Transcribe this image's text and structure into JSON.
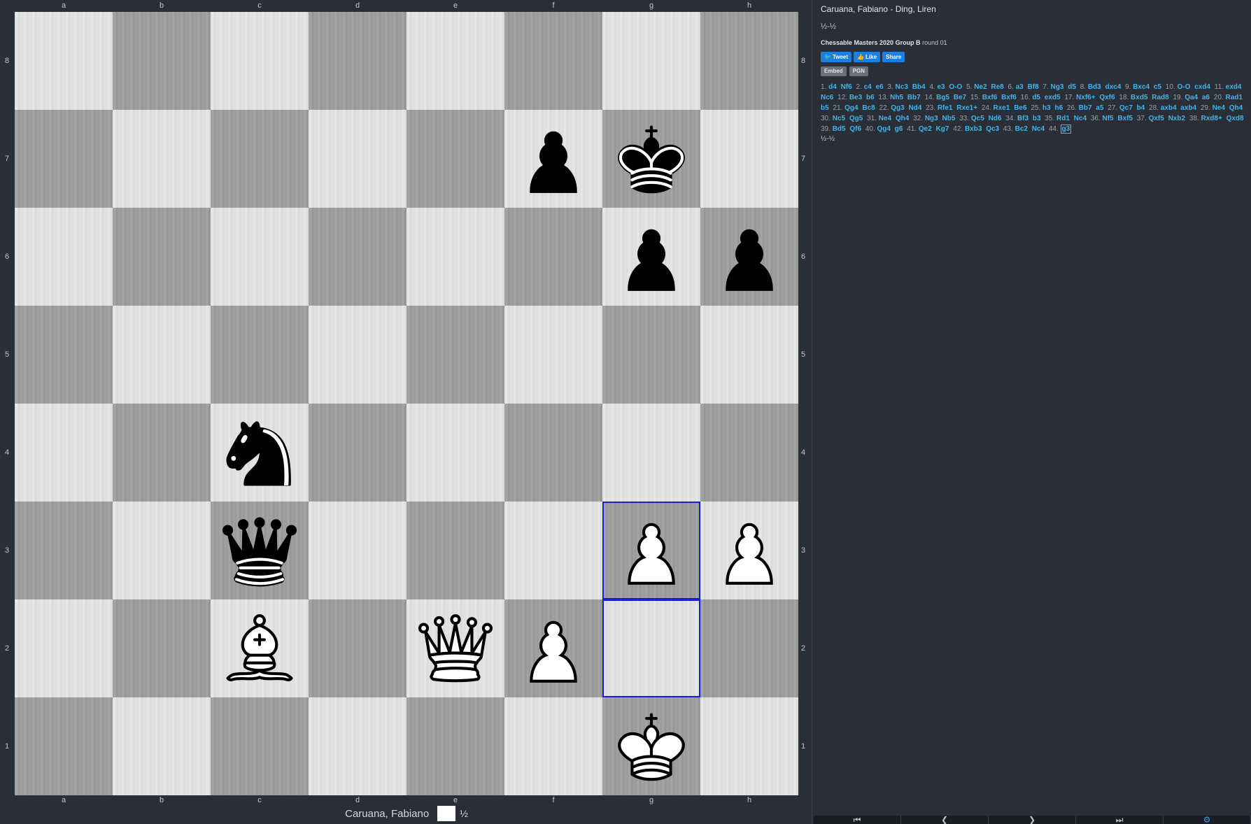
{
  "board": {
    "files": [
      "a",
      "b",
      "c",
      "d",
      "e",
      "f",
      "g",
      "h"
    ],
    "ranks": [
      "8",
      "7",
      "6",
      "5",
      "4",
      "3",
      "2",
      "1"
    ],
    "colors": {
      "light": "#e0e0e0",
      "dark": "#9d9d9d",
      "highlight": "#1a1ad8"
    },
    "highlighted_squares": [
      "g3",
      "g2"
    ],
    "pieces": [
      {
        "square": "f7",
        "piece": "black-pawn"
      },
      {
        "square": "g7",
        "piece": "black-king"
      },
      {
        "square": "g6",
        "piece": "black-pawn"
      },
      {
        "square": "h6",
        "piece": "black-pawn"
      },
      {
        "square": "c4",
        "piece": "black-knight"
      },
      {
        "square": "c3",
        "piece": "black-queen"
      },
      {
        "square": "g3",
        "piece": "white-pawn"
      },
      {
        "square": "h3",
        "piece": "white-pawn"
      },
      {
        "square": "c2",
        "piece": "white-bishop"
      },
      {
        "square": "e2",
        "piece": "white-queen"
      },
      {
        "square": "f2",
        "piece": "white-pawn"
      },
      {
        "square": "g1",
        "piece": "white-king"
      }
    ]
  },
  "player_bar": {
    "name": "Caruana, Fabiano",
    "score": "½"
  },
  "game": {
    "title": "Caruana, Fabiano - Ding, Liren",
    "result": "½-½",
    "event": "Chessable Masters 2020 Group B",
    "round": "round 01"
  },
  "social": {
    "tweet": "Tweet",
    "like": "Like",
    "share": "Share"
  },
  "tools": {
    "embed": "Embed",
    "pgn": "PGN"
  },
  "moves": [
    {
      "n": "1.",
      "w": "d4",
      "b": "Nf6"
    },
    {
      "n": "2.",
      "w": "c4",
      "b": "e6"
    },
    {
      "n": "3.",
      "w": "Nc3",
      "b": "Bb4"
    },
    {
      "n": "4.",
      "w": "e3",
      "b": "O-O"
    },
    {
      "n": "5.",
      "w": "Ne2",
      "b": "Re8"
    },
    {
      "n": "6.",
      "w": "a3",
      "b": "Bf8"
    },
    {
      "n": "7.",
      "w": "Ng3",
      "b": "d5"
    },
    {
      "n": "8.",
      "w": "Bd3",
      "b": "dxc4"
    },
    {
      "n": "9.",
      "w": "Bxc4",
      "b": "c5"
    },
    {
      "n": "10.",
      "w": "O-O",
      "b": "cxd4"
    },
    {
      "n": "11.",
      "w": "exd4",
      "b": "Nc6"
    },
    {
      "n": "12.",
      "w": "Be3",
      "b": "b6"
    },
    {
      "n": "13.",
      "w": "Nh5",
      "b": "Bb7"
    },
    {
      "n": "14.",
      "w": "Bg5",
      "b": "Be7"
    },
    {
      "n": "15.",
      "w": "Bxf6",
      "b": "Bxf6"
    },
    {
      "n": "16.",
      "w": "d5",
      "b": "exd5"
    },
    {
      "n": "17.",
      "w": "Nxf6+",
      "b": "Qxf6"
    },
    {
      "n": "18.",
      "w": "Bxd5",
      "b": "Rad8"
    },
    {
      "n": "19.",
      "w": "Qa4",
      "b": "a6"
    },
    {
      "n": "20.",
      "w": "Rad1",
      "b": "b5"
    },
    {
      "n": "21.",
      "w": "Qg4",
      "b": "Bc8"
    },
    {
      "n": "22.",
      "w": "Qg3",
      "b": "Nd4"
    },
    {
      "n": "23.",
      "w": "Rfe1",
      "b": "Rxe1+"
    },
    {
      "n": "24.",
      "w": "Rxe1",
      "b": "Be6"
    },
    {
      "n": "25.",
      "w": "h3",
      "b": "h6"
    },
    {
      "n": "26.",
      "w": "Bb7",
      "b": "a5"
    },
    {
      "n": "27.",
      "w": "Qc7",
      "b": "b4"
    },
    {
      "n": "28.",
      "w": "axb4",
      "b": "axb4"
    },
    {
      "n": "29.",
      "w": "Ne4",
      "b": "Qh4"
    },
    {
      "n": "30.",
      "w": "Nc5",
      "b": "Qg5"
    },
    {
      "n": "31.",
      "w": "Ne4",
      "b": "Qh4"
    },
    {
      "n": "32.",
      "w": "Ng3",
      "b": "Nb5"
    },
    {
      "n": "33.",
      "w": "Qc5",
      "b": "Nd6"
    },
    {
      "n": "34.",
      "w": "Bf3",
      "b": "b3"
    },
    {
      "n": "35.",
      "w": "Rd1",
      "b": "Nc4"
    },
    {
      "n": "36.",
      "w": "Nf5",
      "b": "Bxf5"
    },
    {
      "n": "37.",
      "w": "Qxf5",
      "b": "Nxb2"
    },
    {
      "n": "38.",
      "w": "Rxd8+",
      "b": "Qxd8"
    },
    {
      "n": "39.",
      "w": "Bd5",
      "b": "Qf6"
    },
    {
      "n": "40.",
      "w": "Qg4",
      "b": "g6"
    },
    {
      "n": "41.",
      "w": "Qe2",
      "b": "Kg7"
    },
    {
      "n": "42.",
      "w": "Bxb3",
      "b": "Qc3"
    },
    {
      "n": "43.",
      "w": "Bc2",
      "b": "Nc4"
    },
    {
      "n": "44.",
      "w": "g3",
      "b": ""
    }
  ],
  "current_move": "g3",
  "final_result": "½-½",
  "nav": [
    {
      "name": "first-move-button",
      "icon": "first-icon",
      "glyph": "⏮"
    },
    {
      "name": "previous-move-button",
      "icon": "previous-icon",
      "glyph": "❮"
    },
    {
      "name": "next-move-button",
      "icon": "next-icon",
      "glyph": "❯"
    },
    {
      "name": "last-move-button",
      "icon": "last-icon",
      "glyph": "⏭"
    },
    {
      "name": "settings-button",
      "icon": "gear-icon",
      "glyph": "⚙"
    }
  ]
}
